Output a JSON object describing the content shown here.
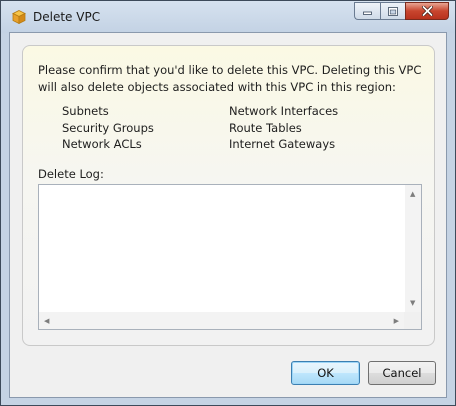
{
  "window": {
    "title": "Delete VPC",
    "app_icon": "aws-cube-icon",
    "controls": [
      "minimize-icon",
      "maximize-icon",
      "close-icon"
    ]
  },
  "dialog": {
    "message": "Please confirm that you'd like to delete this VPC. Deleting this VPC will also delete objects associated with this VPC in this region:",
    "objects": {
      "col1": [
        "Subnets",
        "Security Groups",
        "Network ACLs"
      ],
      "col2": [
        "Network Interfaces",
        "Route Tables",
        "Internet Gateways"
      ]
    },
    "log_label": "Delete Log:",
    "log_value": ""
  },
  "buttons": {
    "ok_label": "OK",
    "cancel_label": "Cancel"
  },
  "colors": {
    "close_button": "#c8452e",
    "panel_tint": "#fbf9e4",
    "default_button_border": "#3c7fb1"
  }
}
